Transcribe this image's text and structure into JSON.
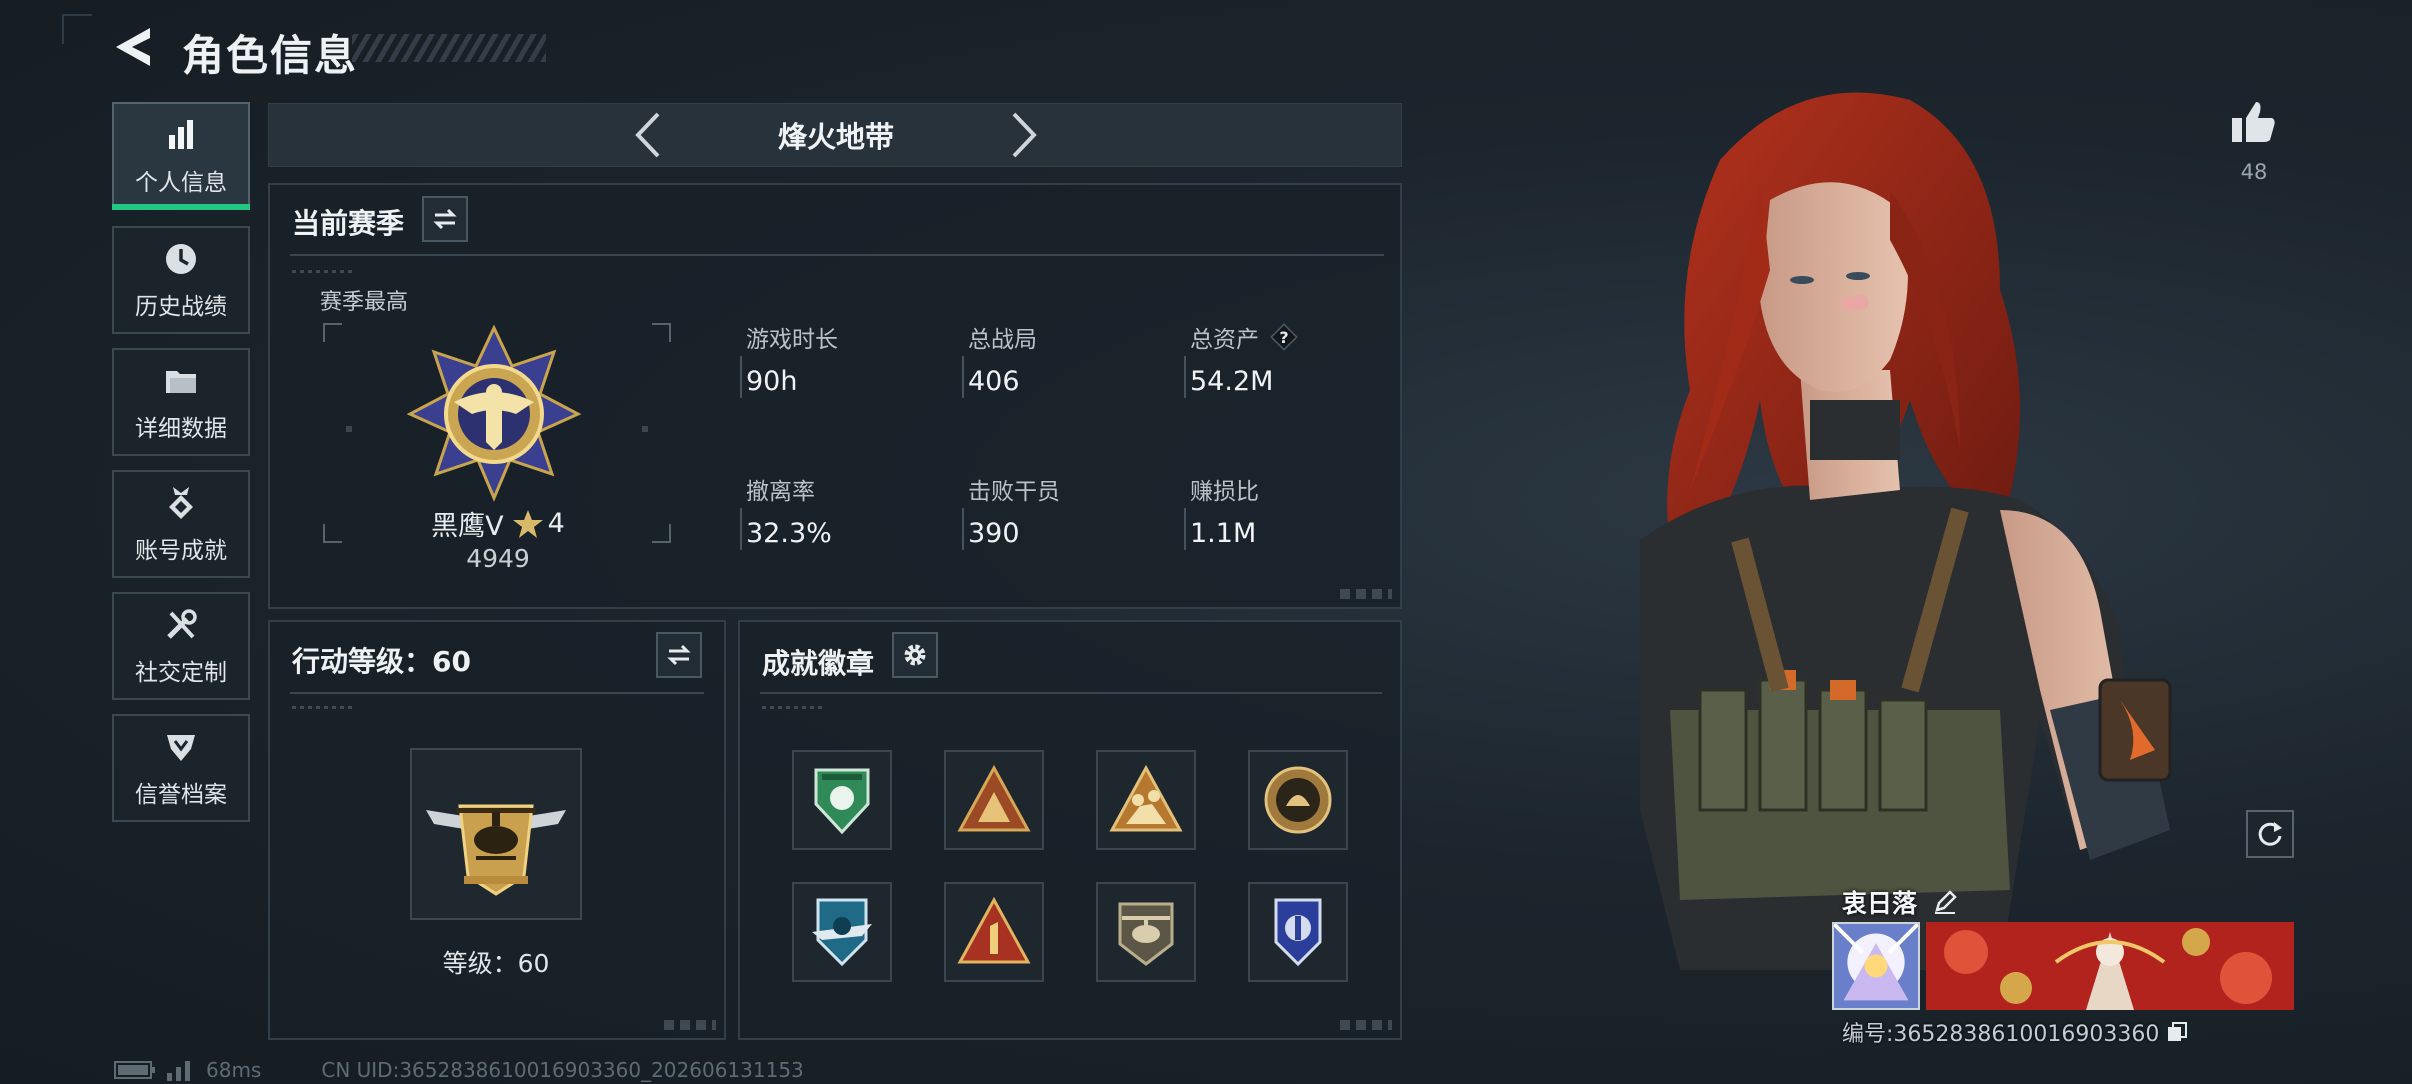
{
  "header": {
    "title": "角色信息"
  },
  "sidebar": {
    "items": [
      {
        "label": "个人信息",
        "icon": "bar-chart-icon",
        "active": true
      },
      {
        "label": "历史战绩",
        "icon": "history-clock-icon",
        "active": false
      },
      {
        "label": "详细数据",
        "icon": "folder-icon",
        "active": false
      },
      {
        "label": "账号成就",
        "icon": "achievement-medal-icon",
        "active": false
      },
      {
        "label": "社交定制",
        "icon": "tools-icon",
        "active": false
      },
      {
        "label": "信誉档案",
        "icon": "credit-shield-icon",
        "active": false
      }
    ]
  },
  "mode_selector": {
    "label": "烽火地带"
  },
  "season": {
    "title": "当前赛季",
    "best_label": "赛季最高",
    "rank_name": "黑鹰V",
    "rank_stars": "4",
    "rank_score": "4949",
    "stats": [
      {
        "label": "游戏时长",
        "value": "90h"
      },
      {
        "label": "总战局",
        "value": "406"
      },
      {
        "label": "总资产",
        "value": "54.2M"
      },
      {
        "label": "撤离率",
        "value": "32.3%"
      },
      {
        "label": "击败干员",
        "value": "390"
      },
      {
        "label": "赚损比",
        "value": "1.1M"
      }
    ]
  },
  "level": {
    "title": "行动等级：60",
    "caption": "等级：60"
  },
  "badges": {
    "title": "成就徽章",
    "items": [
      "green-shield-badge-icon",
      "mountain-triangle-badge-icon",
      "climbers-triangle-badge-icon",
      "gold-coin-badge-icon",
      "blue-wings-badge-icon",
      "number-one-triangle-badge-icon",
      "helicopter-badge-icon",
      "blue-crest-badge-icon"
    ]
  },
  "like": {
    "count": "48"
  },
  "player": {
    "name": "衷日落",
    "id_text": "编号:3652838610016903360"
  },
  "status_bar": {
    "ping": "68ms",
    "uid_text": "CN UID:3652838610016903360_202606131153"
  },
  "colors": {
    "accent_green": "#22c882",
    "panel_border": "#333f48",
    "background": "#1a222a"
  }
}
